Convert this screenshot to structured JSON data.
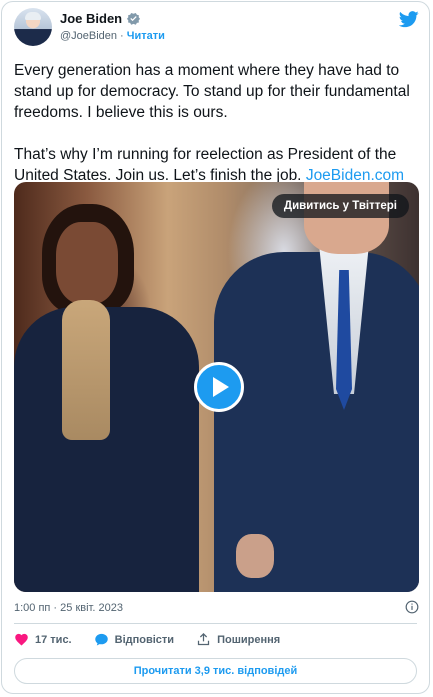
{
  "author": {
    "name": "Joe Biden",
    "handle": "@JoeBiden",
    "separator": "·",
    "follow_label": "Читати"
  },
  "tweet": {
    "text": "Every generation has a moment where they have had to stand up for democracy. To stand up for their fundamental freedoms. I believe this is ours.\n\nThat’s why I’m running for reelection as President of the United States. Join us. Let’s finish the job. ",
    "link": "JoeBiden.com"
  },
  "media": {
    "watch_label": "Дивитись у Твіттері"
  },
  "timestamp": "1:00 пп · 25 квіт. 2023",
  "actions": {
    "likes_count": "17 тис.",
    "reply_label": "Відповісти",
    "share_label": "Поширення"
  },
  "read_replies_label": "Прочитати 3,9 тис. відповідей",
  "colors": {
    "accent": "#1d9bf0",
    "like": "#f91880",
    "text": "#0f1419",
    "muted": "#536471"
  }
}
